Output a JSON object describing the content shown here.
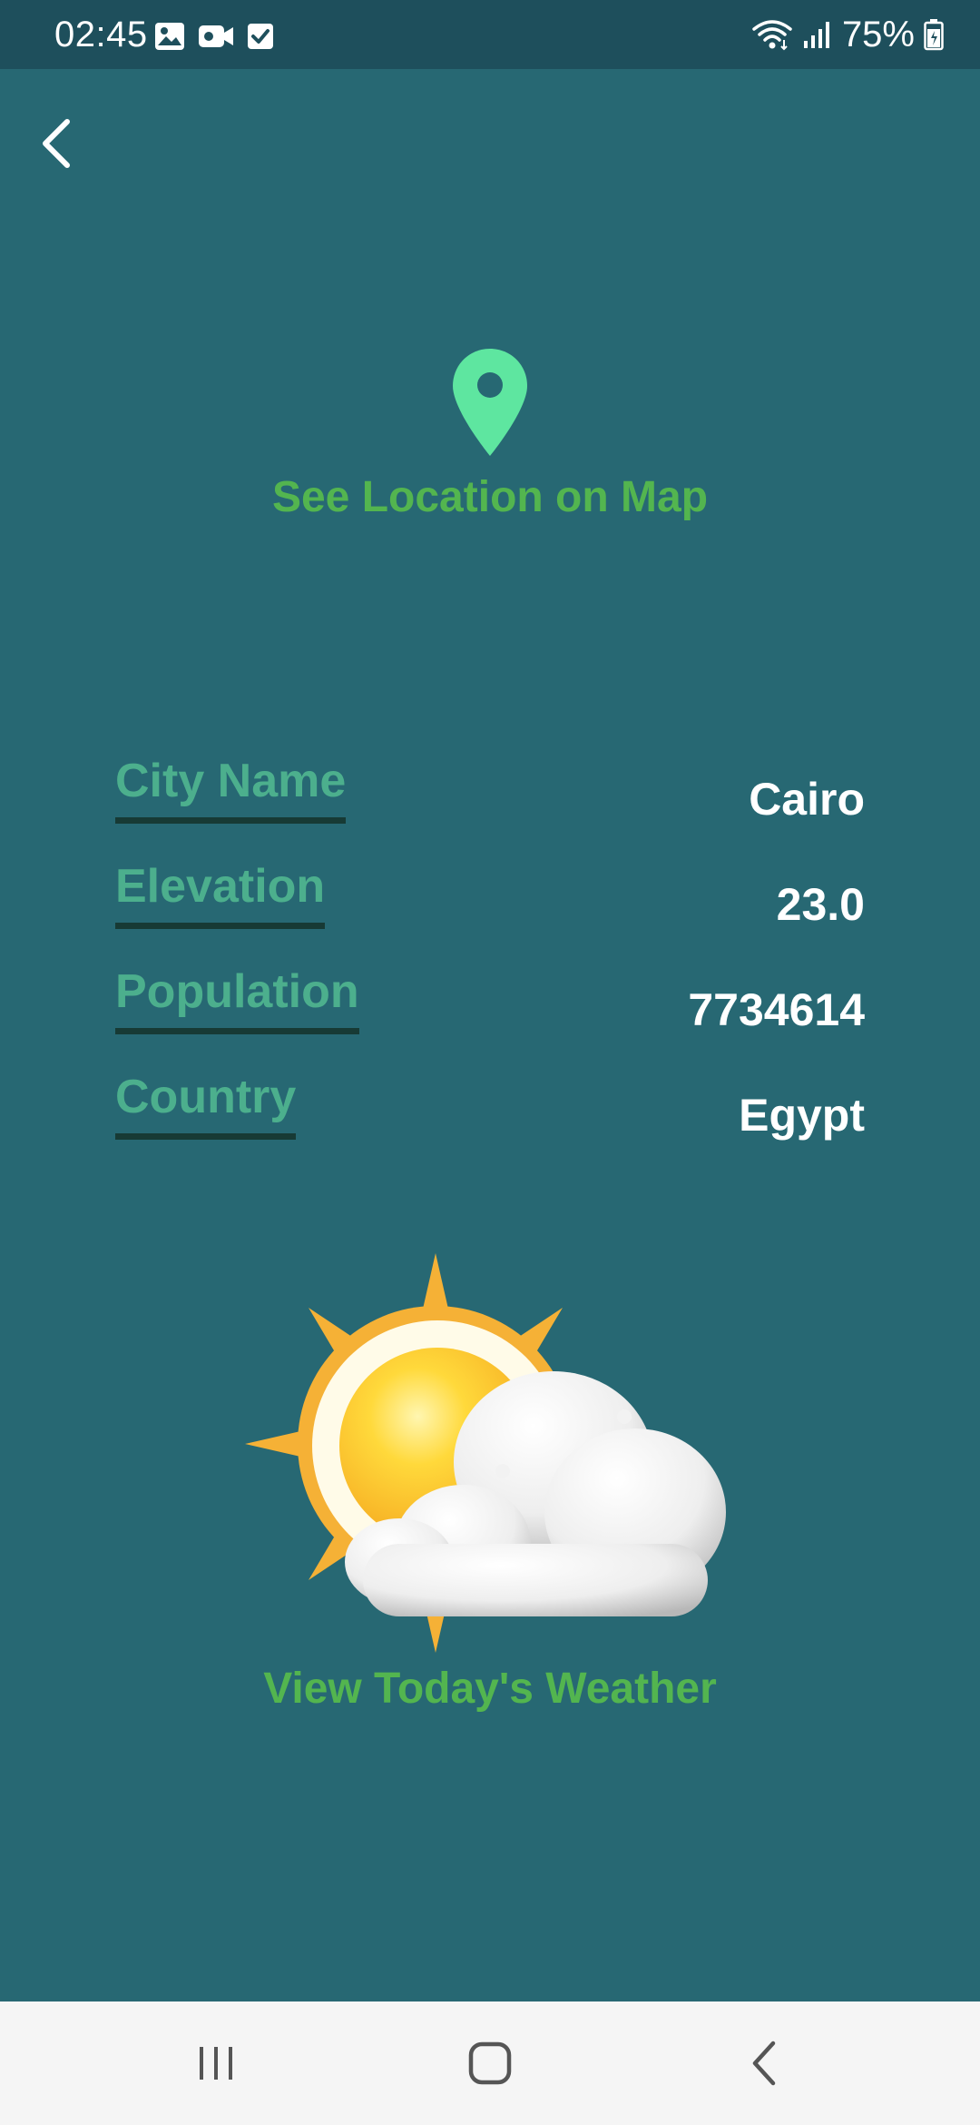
{
  "status_bar": {
    "time": "02:45",
    "battery": "75%",
    "icons": [
      "image-icon",
      "video-icon",
      "checkbox-icon",
      "wifi-icon",
      "signal-icon",
      "battery-icon"
    ]
  },
  "map": {
    "link_label": "See Location on Map",
    "icon": "location-pin-icon"
  },
  "info": {
    "rows": [
      {
        "label": "City Name",
        "value": "Cairo"
      },
      {
        "label": "Elevation",
        "value": "23.0"
      },
      {
        "label": "Population",
        "value": "7734614"
      },
      {
        "label": "Country",
        "value": "Egypt"
      }
    ]
  },
  "weather": {
    "link_label": "View Today's Weather",
    "icon": "partly-sunny-icon"
  },
  "colors": {
    "background": "#276873",
    "status_bar": "#1e4f5c",
    "accent_green": "#53b54f",
    "label_green": "#4caf8d",
    "pin_green": "#5ee6a0"
  }
}
